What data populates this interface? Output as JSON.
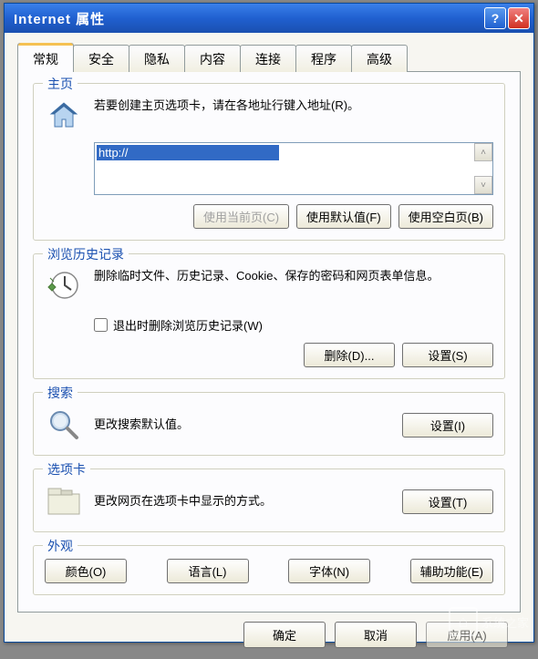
{
  "window": {
    "title": "Internet 属性"
  },
  "tabs": [
    "常规",
    "安全",
    "隐私",
    "内容",
    "连接",
    "程序",
    "高级"
  ],
  "homepage": {
    "legend": "主页",
    "instruction": "若要创建主页选项卡，请在各地址行键入地址(R)。",
    "url": "http://",
    "btn_current": "使用当前页(C)",
    "btn_default": "使用默认值(F)",
    "btn_blank": "使用空白页(B)"
  },
  "history": {
    "legend": "浏览历史记录",
    "instruction": "删除临时文件、历史记录、Cookie、保存的密码和网页表单信息。",
    "checkbox_label": "退出时删除浏览历史记录(W)",
    "btn_delete": "删除(D)...",
    "btn_settings": "设置(S)"
  },
  "search": {
    "legend": "搜索",
    "instruction": "更改搜索默认值。",
    "btn_settings": "设置(I)"
  },
  "tabs_section": {
    "legend": "选项卡",
    "instruction": "更改网页在选项卡中显示的方式。",
    "btn_settings": "设置(T)"
  },
  "appearance": {
    "legend": "外观",
    "btn_colors": "颜色(O)",
    "btn_language": "语言(L)",
    "btn_fonts": "字体(N)",
    "btn_accessibility": "辅助功能(E)"
  },
  "dialog": {
    "btn_ok": "确定",
    "btn_cancel": "取消",
    "btn_apply": "应用(A)"
  },
  "watermark": "系统之家"
}
